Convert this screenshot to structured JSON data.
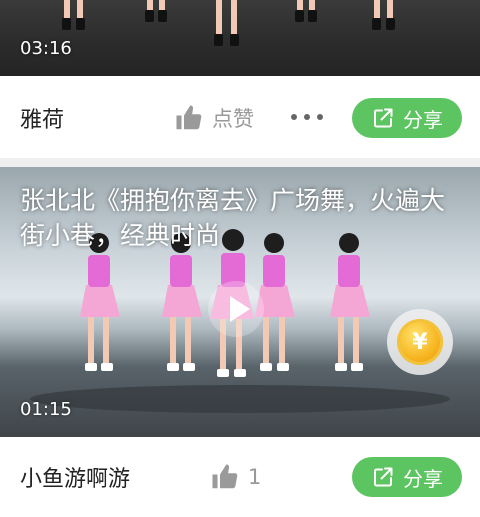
{
  "feed": {
    "items": [
      {
        "duration": "03:16",
        "author": "雅荷",
        "like_label": "点赞",
        "share_label": "分享"
      },
      {
        "title": "张北北《拥抱你离去》广场舞，火遍大街小巷，经典时尚",
        "duration": "01:15",
        "author": "小鱼游啊游",
        "like_count": "1",
        "share_label": "分享"
      }
    ]
  },
  "coin_symbol": "¥",
  "colors": {
    "share_green": "#5cc460",
    "separator": "#efefef",
    "skirt_pink": "#f4a6d4",
    "top_pink": "#e46ad6"
  }
}
